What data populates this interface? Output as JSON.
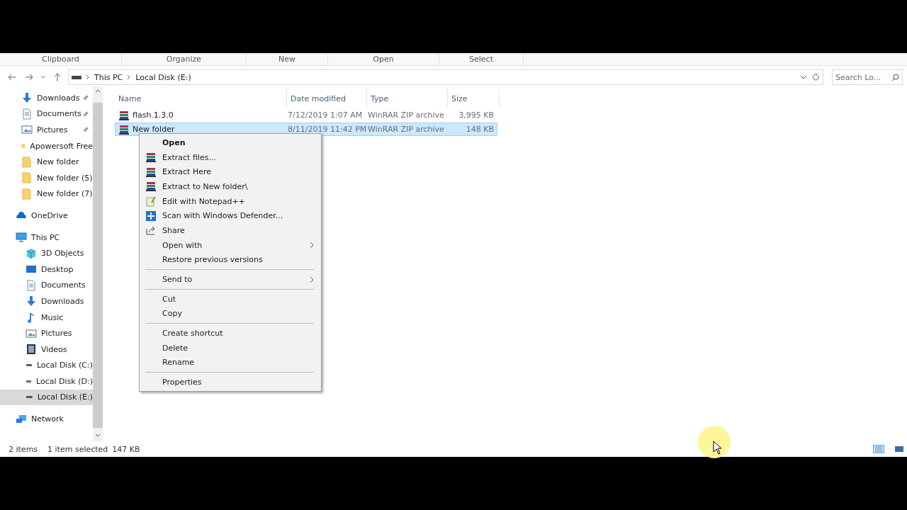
{
  "ribbon": {
    "groups": [
      "Clipboard",
      "Organize",
      "New",
      "Open",
      "Select"
    ]
  },
  "address": {
    "path": [
      "This PC",
      "Local Disk (E:)"
    ],
    "search_placeholder": "Search Lo..."
  },
  "sidebar": {
    "quick_access": [
      {
        "label": "Downloads",
        "kind": "download",
        "pinned": true,
        "selected": false
      },
      {
        "label": "Documents",
        "kind": "document",
        "pinned": true,
        "selected": false
      },
      {
        "label": "Pictures",
        "kind": "picture",
        "pinned": true,
        "selected": false
      },
      {
        "label": "Apowersoft Free",
        "kind": "folder",
        "pinned": false,
        "selected": false
      },
      {
        "label": "New folder",
        "kind": "folder",
        "pinned": false,
        "selected": false
      },
      {
        "label": "New folder (5)",
        "kind": "folder",
        "pinned": false,
        "selected": false
      },
      {
        "label": "New folder (7)",
        "kind": "folder",
        "pinned": false,
        "selected": false
      }
    ],
    "items": [
      {
        "label": "OneDrive",
        "kind": "cloud",
        "selected": false
      },
      {
        "label": "This PC",
        "kind": "pc",
        "selected": false,
        "children": [
          {
            "label": "3D Objects",
            "kind": "cube",
            "selected": false
          },
          {
            "label": "Desktop",
            "kind": "desktop",
            "selected": false
          },
          {
            "label": "Documents",
            "kind": "document",
            "selected": false
          },
          {
            "label": "Downloads",
            "kind": "download",
            "selected": false
          },
          {
            "label": "Music",
            "kind": "music",
            "selected": false
          },
          {
            "label": "Pictures",
            "kind": "picture",
            "selected": false
          },
          {
            "label": "Videos",
            "kind": "video",
            "selected": false
          },
          {
            "label": "Local Disk (C:)",
            "kind": "drive",
            "selected": false
          },
          {
            "label": "Local Disk (D:)",
            "kind": "drive",
            "selected": false
          },
          {
            "label": "Local Disk (E:)",
            "kind": "drive",
            "selected": true
          }
        ]
      },
      {
        "label": "Network",
        "kind": "network",
        "selected": false
      }
    ]
  },
  "table": {
    "columns": [
      "Name",
      "Date modified",
      "Type",
      "Size"
    ],
    "rows": [
      {
        "name": "flash.1.3.0",
        "date": "7/12/2019 1:07 AM",
        "type": "WinRAR ZIP archive",
        "size": "3,995 KB",
        "selected": false
      },
      {
        "name": "New folder",
        "date": "8/11/2019 11:42 PM",
        "type": "WinRAR ZIP archive",
        "size": "148 KB",
        "selected": true
      }
    ]
  },
  "context_menu": {
    "groups": [
      [
        {
          "label": "Open",
          "kind": "plain",
          "default": true,
          "submenu": false
        },
        {
          "label": "Extract files...",
          "kind": "winrar",
          "default": false,
          "submenu": false
        },
        {
          "label": "Extract Here",
          "kind": "winrar",
          "default": false,
          "submenu": false
        },
        {
          "label": "Extract to New folder\\",
          "kind": "winrar",
          "default": false,
          "submenu": false
        },
        {
          "label": "Edit with Notepad++",
          "kind": "notepad",
          "default": false,
          "submenu": false
        },
        {
          "label": "Scan with Windows Defender...",
          "kind": "defender",
          "default": false,
          "submenu": false
        },
        {
          "label": "Share",
          "kind": "share",
          "default": false,
          "submenu": false
        },
        {
          "label": "Open with",
          "kind": "plain",
          "default": false,
          "submenu": true
        },
        {
          "label": "Restore previous versions",
          "kind": "plain",
          "default": false,
          "submenu": false
        }
      ],
      [
        {
          "label": "Send to",
          "kind": "plain",
          "default": false,
          "submenu": true
        }
      ],
      [
        {
          "label": "Cut",
          "kind": "plain",
          "default": false,
          "submenu": false
        },
        {
          "label": "Copy",
          "kind": "plain",
          "default": false,
          "submenu": false
        }
      ],
      [
        {
          "label": "Create shortcut",
          "kind": "plain",
          "default": false,
          "submenu": false
        },
        {
          "label": "Delete",
          "kind": "plain",
          "default": false,
          "submenu": false
        },
        {
          "label": "Rename",
          "kind": "plain",
          "default": false,
          "submenu": false
        }
      ],
      [
        {
          "label": "Properties",
          "kind": "plain",
          "default": false,
          "submenu": false
        }
      ]
    ]
  },
  "status_bar": {
    "count": "2 items",
    "selection": "1 item selected",
    "size": "147 KB"
  }
}
